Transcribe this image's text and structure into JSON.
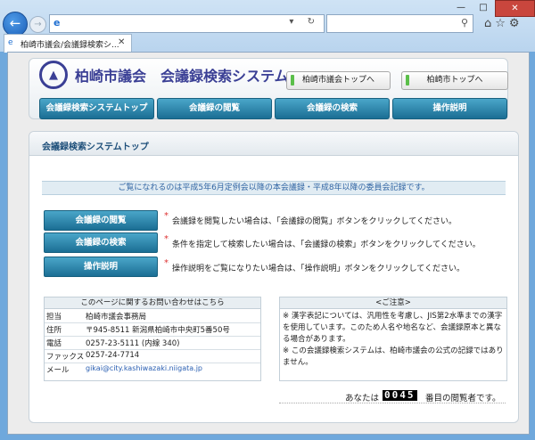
{
  "browser": {
    "tab_title": "柏崎市議会/会議録検索シ...",
    "address": "",
    "search": ""
  },
  "header": {
    "site_title": "柏崎市議会　会議録検索システム",
    "links": [
      "柏崎市議会トップへ",
      "柏崎市トップへ"
    ],
    "nav": [
      "会議録検索システムトップ",
      "会議録の閲覧",
      "会議録の検索",
      "操作説明"
    ]
  },
  "content": {
    "title": "会議録検索システムトップ",
    "notice": "ご覧になれるのは平成5年6月定例会以降の本会議録・平成8年以降の委員会記録です。",
    "actions": [
      {
        "label": "会議録の閲覧",
        "desc": "会議録を閲覧したい場合は、「会議録の閲覧」ボタンをクリックしてください。"
      },
      {
        "label": "会議録の検索",
        "desc": "条件を指定して検索したい場合は、「会議録の検索」ボタンをクリックしてください。"
      },
      {
        "label": "操作説明",
        "desc": "操作説明をご覧になりたい場合は、「操作説明」ボタンをクリックしてください。"
      }
    ],
    "contact": {
      "title": "このページに関するお問い合わせはこちら",
      "rows": [
        {
          "label": "担当",
          "value": "柏崎市議会事務局"
        },
        {
          "label": "住所",
          "value": "〒945-8511 新潟県柏崎市中央町5番50号"
        },
        {
          "label": "電話",
          "value": "0257-23-5111 (内線 340)"
        },
        {
          "label": "ファックス",
          "value": "0257-24-7714"
        },
        {
          "label": "メール",
          "value": "gikai@city.kashiwazaki.niigata.jp"
        }
      ]
    },
    "caution": {
      "title": "<ご注意>",
      "lines": [
        "※ 漢字表記については、汎用性を考慮し、JIS第2水準までの漢字を使用しています。このため人名や地名など、会議録原本と異なる場合があります。",
        "※ この会議録検索システムは、柏崎市議会の公式の記録ではありません。"
      ]
    },
    "counter": {
      "prefix": "あなたは",
      "value": "0045",
      "suffix": "番目の閲覧者です。"
    }
  }
}
